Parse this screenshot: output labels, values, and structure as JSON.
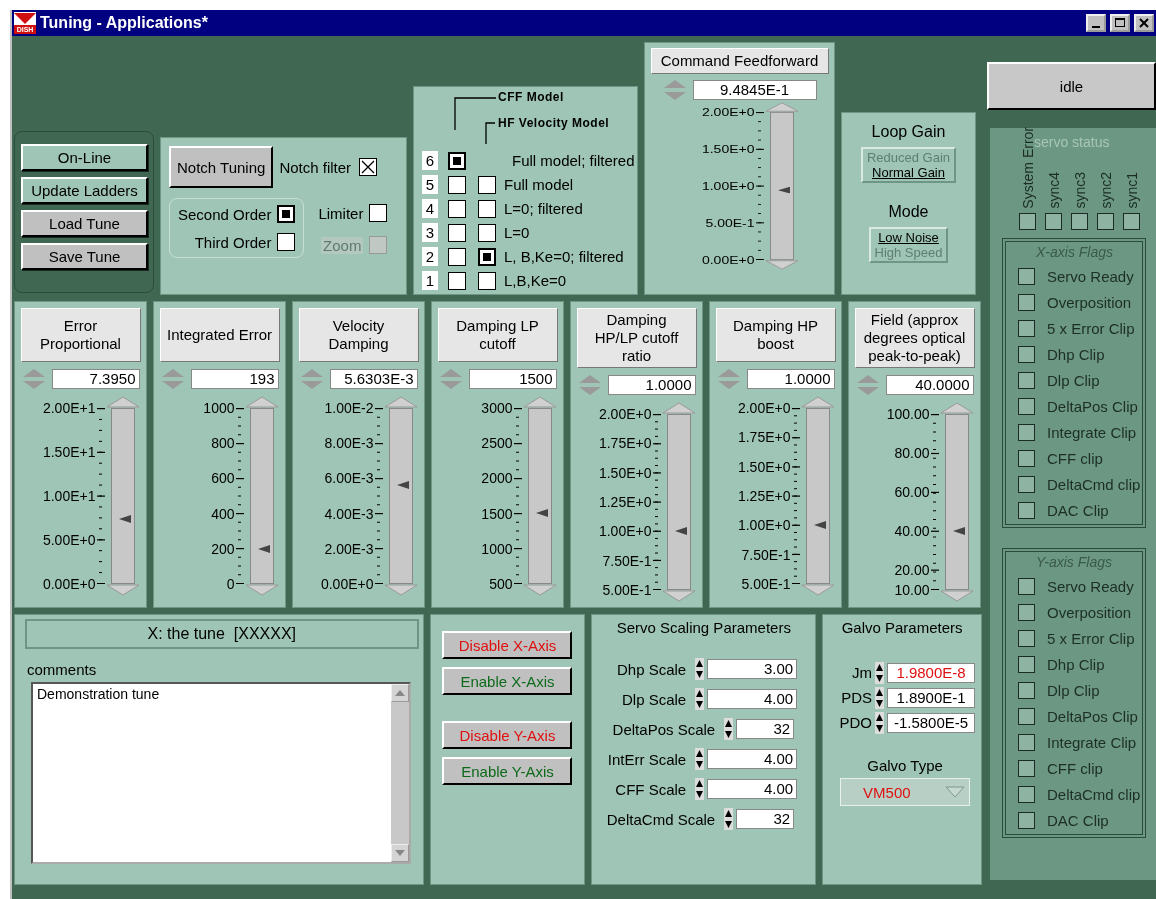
{
  "window": {
    "title": "Tuning - Applications*",
    "logo": "DISH"
  },
  "actions": [
    {
      "label": "On-Line",
      "kind": "light"
    },
    {
      "label": "Update Ladders",
      "kind": "light"
    },
    {
      "label": "Load Tune",
      "kind": "grey"
    },
    {
      "label": "Save Tune",
      "kind": "grey"
    }
  ],
  "notch": {
    "button": "Notch Tuning",
    "notch_filter": {
      "label": "Notch filter",
      "checked": true
    },
    "orders": [
      {
        "label": "Second Order",
        "selected": true
      },
      {
        "label": "Third Order",
        "selected": false
      }
    ],
    "limiter": {
      "label": "Limiter",
      "checked": false
    },
    "zoom": {
      "label": "Zoom",
      "checked": false,
      "disabled": true
    }
  },
  "models": {
    "cff_label": "CFF Model",
    "hf_label": "HF Velocity Model",
    "rows": [
      {
        "number": "6",
        "label": "Full model; filtered",
        "cff": true
      },
      {
        "number": "5",
        "label": "Full model",
        "cff": false,
        "hf": false
      },
      {
        "number": "4",
        "label": "L=0; filtered",
        "cff": false,
        "hf": false
      },
      {
        "number": "3",
        "label": "L=0",
        "cff": false,
        "hf": false
      },
      {
        "number": "2",
        "label": "L, B,Ke=0; filtered",
        "cff": false,
        "hf": true
      },
      {
        "number": "1",
        "label": "L,B,Ke=0",
        "cff": false,
        "hf": false
      }
    ]
  },
  "command_feedforward": {
    "title": "Command Feedforward",
    "value": "9.4845E-1",
    "ticks": [
      "2.00E+0",
      "1.50E+0",
      "1.00E+0",
      "5.00E-1",
      "0.00E+0"
    ],
    "level": 0.474
  },
  "loop_gain": {
    "title": "Loop Gain",
    "options": [
      {
        "label": "Reduced Gain",
        "selected": false
      },
      {
        "label": "Normal Gain",
        "selected": true
      }
    ]
  },
  "mode": {
    "title": "Mode",
    "options": [
      {
        "label": "Low Noise",
        "selected": true
      },
      {
        "label": "High Speed",
        "selected": false
      }
    ]
  },
  "sliders": [
    {
      "title": "Error Proportional",
      "value": "7.3950",
      "ticks": [
        "2.00E+1",
        "1.50E+1",
        "1.00E+1",
        "5.00E+0",
        "0.00E+0"
      ],
      "level": 0.37
    },
    {
      "title": "Integrated Error",
      "value": "193",
      "ticks": [
        "1000",
        "800",
        "600",
        "400",
        "200",
        "0"
      ],
      "level": 0.193
    },
    {
      "title": "Velocity Damping",
      "value": "5.6303E-3",
      "ticks": [
        "1.00E-2",
        "8.00E-3",
        "6.00E-3",
        "4.00E-3",
        "2.00E-3",
        "0.00E+0"
      ],
      "level": 0.563
    },
    {
      "title": "Damping LP cutoff",
      "value": "1500",
      "ticks": [
        "3000",
        "2500",
        "2000",
        "1500",
        "1000",
        "500"
      ],
      "level": 0.4
    },
    {
      "title": "Damping HP/LP cutoff ratio",
      "value": "1.0000",
      "ticks": [
        "2.00E+0",
        "1.75E+0",
        "1.50E+0",
        "1.25E+0",
        "1.00E+0",
        "7.50E-1",
        "5.00E-1"
      ],
      "level": 0.333
    },
    {
      "title": "Damping HP boost",
      "value": "1.0000",
      "ticks": [
        "2.00E+0",
        "1.75E+0",
        "1.50E+0",
        "1.25E+0",
        "1.00E+0",
        "7.50E-1",
        "5.00E-1"
      ],
      "level": 0.333
    },
    {
      "title": "Field (approx degrees optical peak-to-peak)",
      "value": "40.0000",
      "ticks": [
        "100.00",
        "80.00",
        "60.00",
        "40.00",
        "20.00",
        "10.00"
      ],
      "level": 0.333
    }
  ],
  "tune": {
    "title": "X: the tune  [XXXXX]",
    "comments_label": "comments",
    "comments": "Demonstration tune"
  },
  "axis_buttons": [
    {
      "label": "Disable X-Axis",
      "kind": "disable"
    },
    {
      "label": "Enable X-Axis",
      "kind": "enable"
    },
    {
      "label": "Disable Y-Axis",
      "kind": "disable"
    },
    {
      "label": "Enable Y-Axis",
      "kind": "enable"
    }
  ],
  "scaling": {
    "title": "Servo Scaling Parameters",
    "params": [
      {
        "label": "Dhp Scale",
        "value": "3.00",
        "kind": "wide"
      },
      {
        "label": "Dlp Scale",
        "value": "4.00",
        "kind": "wide"
      },
      {
        "label": "DeltaPos Scale",
        "value": "32",
        "kind": "narrow"
      },
      {
        "label": "IntErr Scale",
        "value": "4.00",
        "kind": "wide"
      },
      {
        "label": "CFF Scale",
        "value": "4.00",
        "kind": "wide"
      },
      {
        "label": "DeltaCmd Scale",
        "value": "32",
        "kind": "narrow"
      }
    ]
  },
  "galvo": {
    "title": "Galvo Parameters",
    "params": [
      {
        "label": "Jm",
        "value": "1.9800E-8",
        "alert": true
      },
      {
        "label": "PDS",
        "value": "1.8900E-1",
        "alert": false
      },
      {
        "label": "PDO",
        "value": "-1.5800E-5",
        "alert": false
      }
    ],
    "type_label": "Galvo Type",
    "type_value": "VM500"
  },
  "status": {
    "button": "idle"
  },
  "servo_status": {
    "title": "servo status",
    "indicators": [
      {
        "label": "System Error",
        "on": false
      },
      {
        "label": "sync4",
        "on": false
      },
      {
        "label": "sync3",
        "on": false
      },
      {
        "label": "sync2",
        "on": false
      },
      {
        "label": "sync1",
        "on": false
      }
    ]
  },
  "x_flags": {
    "title": "X-axis Flags",
    "flags": [
      {
        "label": "Servo Ready",
        "on": false
      },
      {
        "label": "Overposition",
        "on": false
      },
      {
        "label": "5 x Error Clip",
        "on": false
      },
      {
        "label": "Dhp Clip",
        "on": false
      },
      {
        "label": "Dlp Clip",
        "on": false
      },
      {
        "label": "DeltaPos Clip",
        "on": false
      },
      {
        "label": "Integrate Clip",
        "on": false
      },
      {
        "label": "CFF clip",
        "on": false
      },
      {
        "label": "DeltaCmd clip",
        "on": false
      },
      {
        "label": "DAC Clip",
        "on": false
      }
    ]
  },
  "y_flags": {
    "title": "Y-axis Flags",
    "flags": [
      {
        "label": "Servo Ready",
        "on": false
      },
      {
        "label": "Overposition",
        "on": false
      },
      {
        "label": "5 x Error Clip",
        "on": false
      },
      {
        "label": "Dhp Clip",
        "on": false
      },
      {
        "label": "Dlp Clip",
        "on": false
      },
      {
        "label": "DeltaPos Clip",
        "on": false
      },
      {
        "label": "Integrate Clip",
        "on": false
      },
      {
        "label": "CFF clip",
        "on": false
      },
      {
        "label": "DeltaCmd clip",
        "on": false
      },
      {
        "label": "DAC Clip",
        "on": false
      }
    ]
  }
}
